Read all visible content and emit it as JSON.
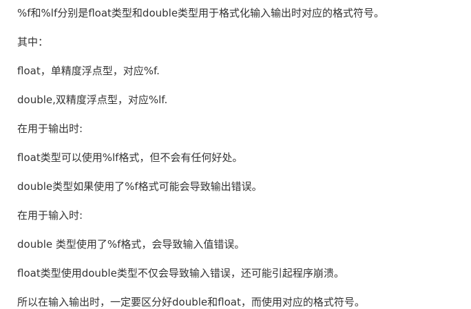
{
  "article": {
    "paragraphs": [
      "%f和%lf分别是float类型和double类型用于格式化输入输出时对应的格式符号。",
      "其中：",
      "float，单精度浮点型，对应%f.",
      "double,双精度浮点型，对应%lf.",
      "在用于输出时:",
      "float类型可以使用%lf格式，但不会有任何好处。",
      "double类型如果使用了%f格式可能会导致输出错误。",
      "在用于输入时:",
      "double 类型使用了%f格式，会导致输入值错误。",
      "float类型使用double类型不仅会导致输入错误，还可能引起程序崩溃。",
      "所以在输入输出时，一定要区分好double和float，而使用对应的格式符号。"
    ]
  }
}
